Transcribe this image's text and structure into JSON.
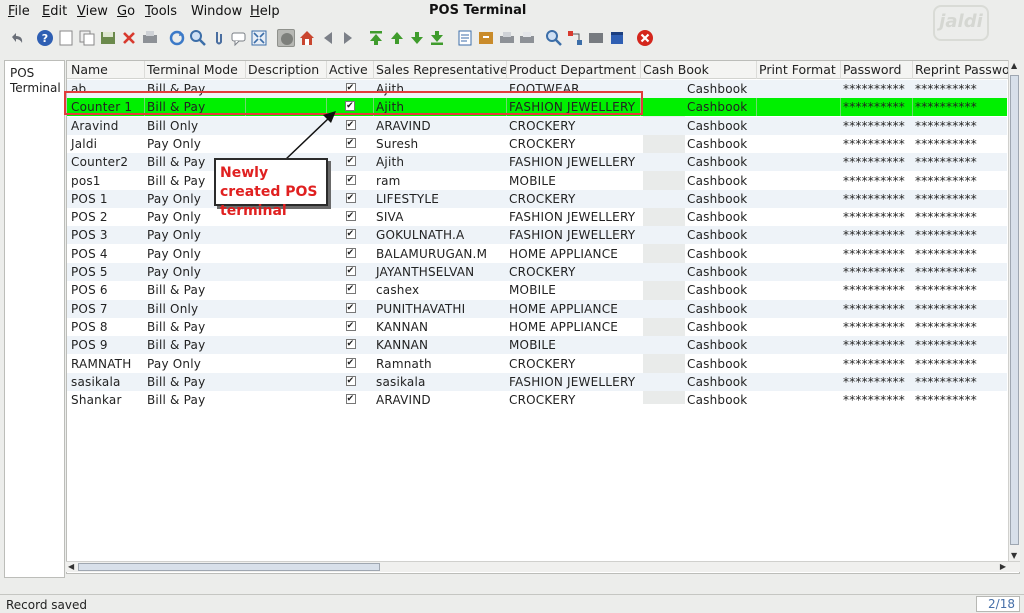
{
  "menubar": {
    "title": "POS Terminal",
    "items": [
      {
        "first": "F",
        "rest": "ile"
      },
      {
        "first": "E",
        "rest": "dit"
      },
      {
        "first": "V",
        "rest": "iew"
      },
      {
        "first": "G",
        "rest": "o"
      },
      {
        "first": "T",
        "rest": "ools"
      },
      {
        "first": "",
        "rest": "Window"
      },
      {
        "first": "H",
        "rest": "elp"
      }
    ],
    "logo": "jaldi"
  },
  "toolbar": {
    "icons": [
      "undo-icon",
      "help-icon",
      "new-icon",
      "copy-icon",
      "save-icon",
      "delete-icon",
      "print-icon",
      "refresh-icon",
      "find-icon",
      "attachment-icon",
      "chat-icon",
      "zoom-fit-icon",
      "history-icon",
      "home-icon",
      "previous-icon",
      "next-icon",
      "first-record-icon",
      "up-record-icon",
      "down-record-icon",
      "last-record-icon",
      "report-icon",
      "archive-icon",
      "print-preview-icon",
      "product-info-icon",
      "zoom-across-icon",
      "workflow-icon",
      "request-icon",
      "window-icon",
      "close-window-icon"
    ]
  },
  "tree": {
    "item": "POS\nTerminal"
  },
  "grid": {
    "columns": [
      "Name",
      "Terminal Mode",
      "Description",
      "Active",
      "Sales Representative",
      "Product Department",
      "Cash Book",
      "Print Format",
      "Password",
      "Reprint Password"
    ],
    "rows": [
      {
        "name": "ab",
        "mode": "Bill & Pay",
        "desc": "",
        "active": "✔",
        "rep": "Ajith",
        "dept": "FOOTWEAR",
        "cashbook": "Cashbook",
        "print": "",
        "password": "**********",
        "reprint": "**********"
      },
      {
        "name": "Counter 1",
        "mode": "Bill & Pay",
        "desc": "",
        "active": "✔",
        "rep": "Ajith",
        "dept": "FASHION JEWELLERY",
        "cashbook": "Cashbook",
        "print": "",
        "password": "**********",
        "reprint": "**********"
      },
      {
        "name": "Aravind",
        "mode": "Bill Only",
        "desc": "",
        "active": "✔",
        "rep": "ARAVIND",
        "dept": "CROCKERY",
        "cashbook": "Cashbook",
        "print": "",
        "password": "**********",
        "reprint": "**********"
      },
      {
        "name": "Jaldi",
        "mode": "Pay Only",
        "desc": "",
        "active": "✔",
        "rep": "Suresh",
        "dept": "CROCKERY",
        "cashbook": "Cashbook",
        "print": "",
        "password": "**********",
        "reprint": "**********"
      },
      {
        "name": "Counter2",
        "mode": "Bill & Pay",
        "desc": "",
        "active": "✔",
        "rep": "Ajith",
        "dept": "FASHION JEWELLERY",
        "cashbook": "Cashbook",
        "print": "",
        "password": "**********",
        "reprint": "**********"
      },
      {
        "name": "pos1",
        "mode": "Bill & Pay",
        "desc": "",
        "active": "✔",
        "rep": "ram",
        "dept": "MOBILE",
        "cashbook": "Cashbook",
        "print": "",
        "password": "**********",
        "reprint": "**********"
      },
      {
        "name": "POS 1",
        "mode": "Pay Only",
        "desc": "",
        "active": "✔",
        "rep": "LIFESTYLE",
        "dept": "CROCKERY",
        "cashbook": "Cashbook",
        "print": "",
        "password": "**********",
        "reprint": "**********"
      },
      {
        "name": "POS 2",
        "mode": "Pay Only",
        "desc": "",
        "active": "✔",
        "rep": "SIVA",
        "dept": "FASHION JEWELLERY",
        "cashbook": "Cashbook",
        "print": "",
        "password": "**********",
        "reprint": "**********"
      },
      {
        "name": "POS 3",
        "mode": "Pay Only",
        "desc": "",
        "active": "✔",
        "rep": "GOKULNATH.A",
        "dept": "FASHION JEWELLERY",
        "cashbook": "Cashbook",
        "print": "",
        "password": "**********",
        "reprint": "**********"
      },
      {
        "name": "POS 4",
        "mode": "Pay Only",
        "desc": "",
        "active": "✔",
        "rep": "BALAMURUGAN.M",
        "dept": "HOME APPLIANCE",
        "cashbook": "Cashbook",
        "print": "",
        "password": "**********",
        "reprint": "**********"
      },
      {
        "name": "POS 5",
        "mode": "Pay Only",
        "desc": "",
        "active": "✔",
        "rep": "JAYANTHSELVAN",
        "dept": "CROCKERY",
        "cashbook": "Cashbook",
        "print": "",
        "password": "**********",
        "reprint": "**********"
      },
      {
        "name": "POS 6",
        "mode": "Bill & Pay",
        "desc": "",
        "active": "✔",
        "rep": "cashex",
        "dept": "MOBILE",
        "cashbook": "Cashbook",
        "print": "",
        "password": "**********",
        "reprint": "**********"
      },
      {
        "name": "POS 7",
        "mode": "Bill Only",
        "desc": "",
        "active": "✔",
        "rep": "PUNITHAVATHI",
        "dept": "HOME APPLIANCE",
        "cashbook": "Cashbook",
        "print": "",
        "password": "**********",
        "reprint": "**********"
      },
      {
        "name": "POS 8",
        "mode": "Bill & Pay",
        "desc": "",
        "active": "✔",
        "rep": "KANNAN",
        "dept": "HOME APPLIANCE",
        "cashbook": "Cashbook",
        "print": "",
        "password": "**********",
        "reprint": "**********"
      },
      {
        "name": "POS 9",
        "mode": "Bill & Pay",
        "desc": "",
        "active": "✔",
        "rep": "KANNAN",
        "dept": "MOBILE",
        "cashbook": "Cashbook",
        "print": "",
        "password": "**********",
        "reprint": "**********"
      },
      {
        "name": "RAMNATH",
        "mode": "Pay Only",
        "desc": "",
        "active": "✔",
        "rep": "Ramnath",
        "dept": "CROCKERY",
        "cashbook": "Cashbook",
        "print": "",
        "password": "**********",
        "reprint": "**********"
      },
      {
        "name": "sasikala",
        "mode": "Bill & Pay",
        "desc": "",
        "active": "✔",
        "rep": "sasikala",
        "dept": "FASHION JEWELLERY",
        "cashbook": "Cashbook",
        "print": "",
        "password": "**********",
        "reprint": "**********"
      },
      {
        "name": "Shankar",
        "mode": "Bill & Pay",
        "desc": "",
        "active": "✔",
        "rep": "ARAVIND",
        "dept": "CROCKERY",
        "cashbook": "Cashbook",
        "print": "",
        "password": "**********",
        "reprint": "**********"
      }
    ],
    "selected_index": 1
  },
  "annotation": {
    "text": "Newly created POS terminal"
  },
  "status": {
    "message": "Record saved",
    "page": "2/18"
  },
  "colors": {
    "selected_row": "#00f000",
    "annotation": "#e02020",
    "alt_row": "#eef3f8"
  }
}
